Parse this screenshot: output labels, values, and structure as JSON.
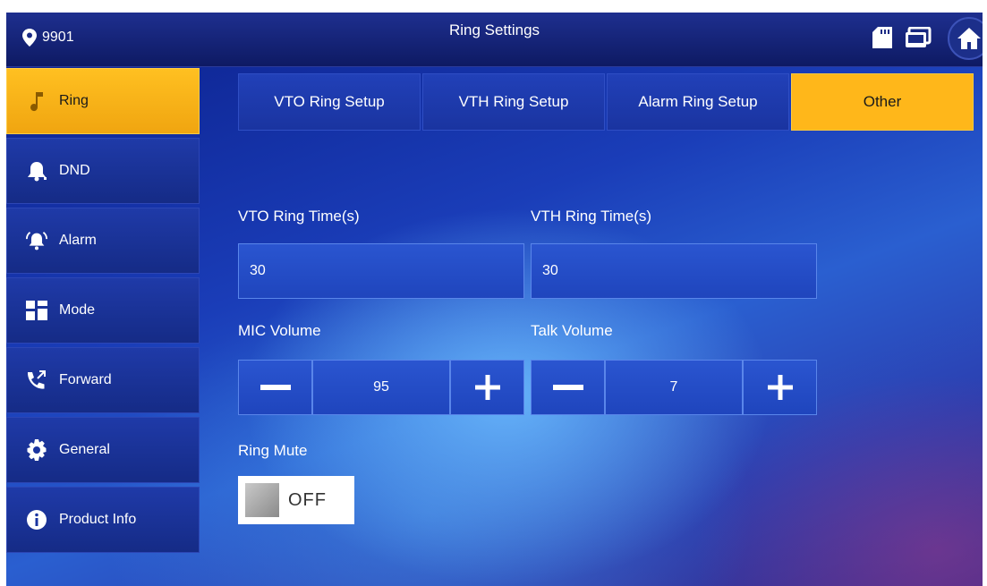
{
  "header": {
    "location": "9901",
    "title": "Ring Settings"
  },
  "sidebar": {
    "items": [
      {
        "label": "Ring"
      },
      {
        "label": "DND"
      },
      {
        "label": "Alarm"
      },
      {
        "label": "Mode"
      },
      {
        "label": "Forward"
      },
      {
        "label": "General"
      },
      {
        "label": "Product Info"
      }
    ]
  },
  "tabs": [
    {
      "label": "VTO Ring Setup"
    },
    {
      "label": "VTH Ring Setup"
    },
    {
      "label": "Alarm Ring Setup"
    },
    {
      "label": "Other"
    }
  ],
  "form": {
    "vto_ring_time": {
      "label": "VTO Ring Time(s)",
      "value": "30"
    },
    "vth_ring_time": {
      "label": "VTH Ring Time(s)",
      "value": "30"
    },
    "mic_volume": {
      "label": "MIC Volume",
      "value": "95"
    },
    "talk_volume": {
      "label": "Talk Volume",
      "value": "7"
    },
    "ring_mute": {
      "label": "Ring Mute",
      "state": "OFF"
    }
  },
  "colors": {
    "accent": "#ffb71a",
    "background": "#1a3db8"
  }
}
